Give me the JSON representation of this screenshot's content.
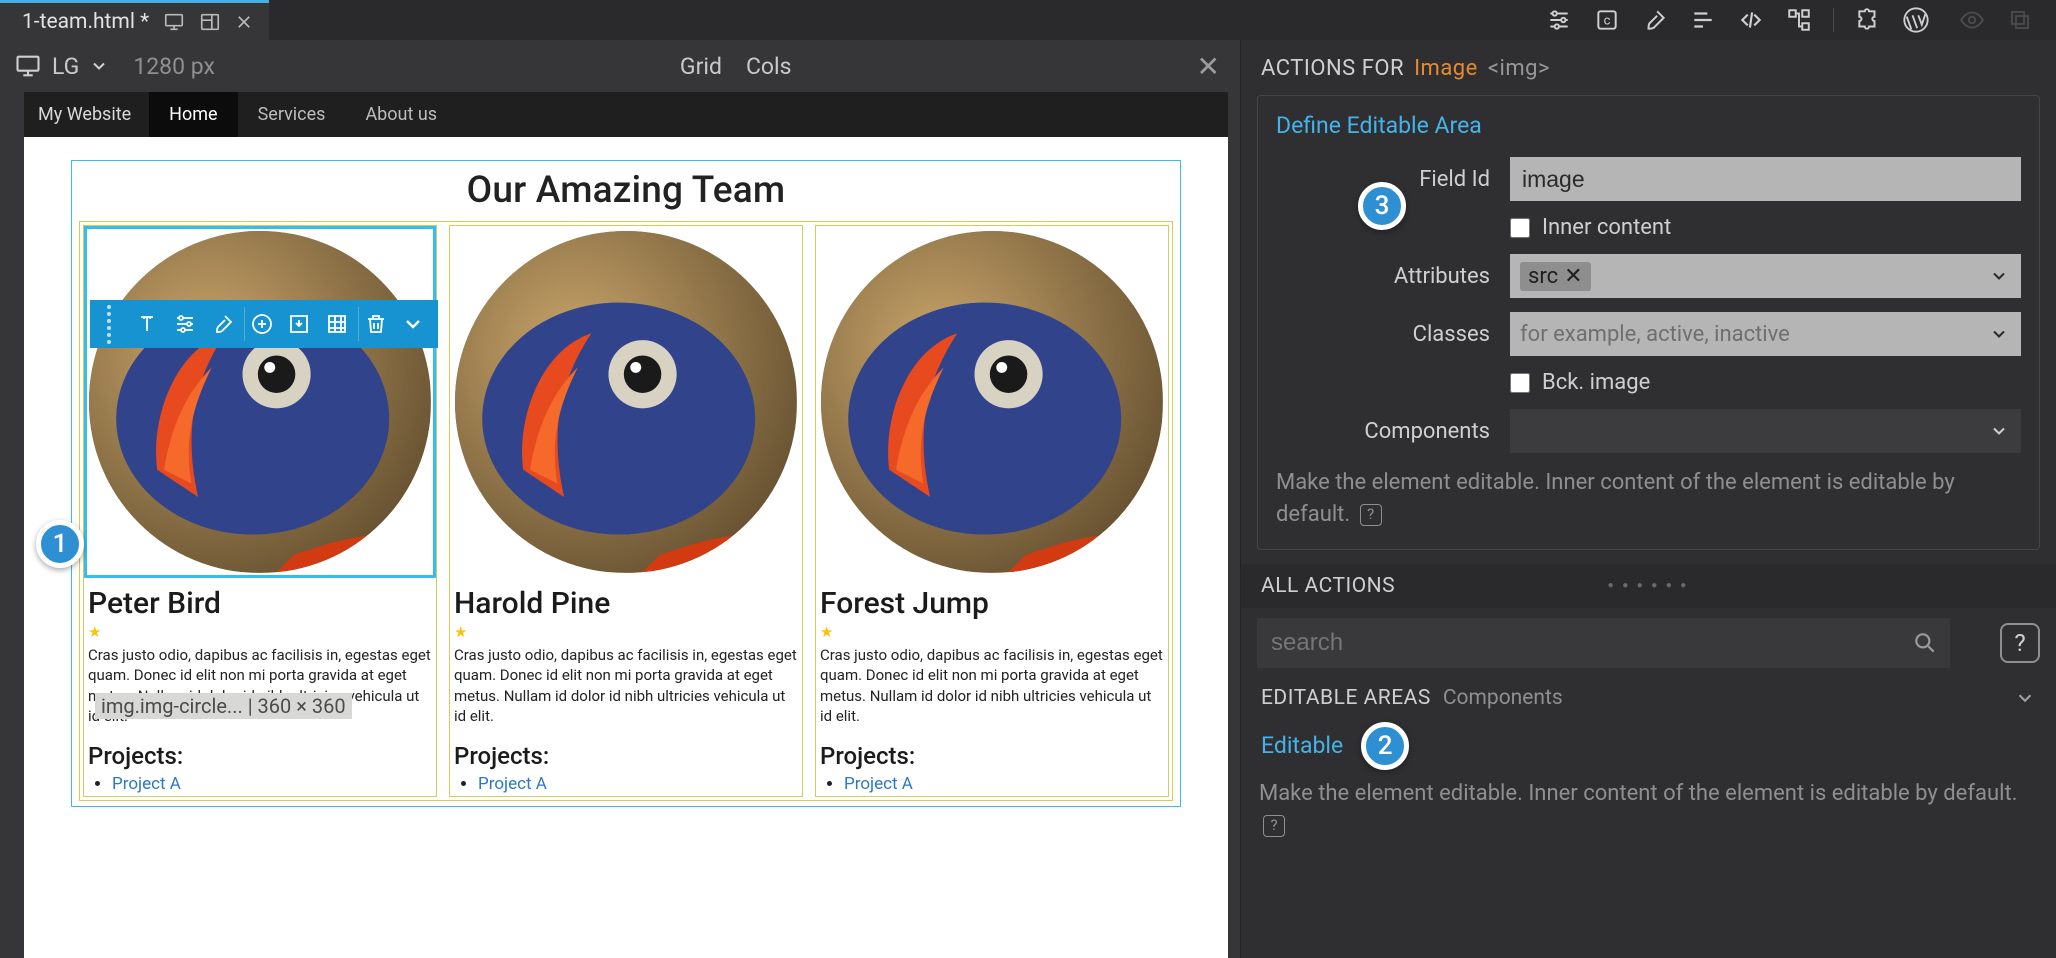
{
  "tab": {
    "filename": "1-team.html *"
  },
  "canvasBar": {
    "device": "LG",
    "width": "1280 px",
    "grid": "Grid",
    "cols": "Cols"
  },
  "siteNav": {
    "brand": "My Website",
    "items": [
      "Home",
      "Services",
      "About us"
    ],
    "activeIndex": 0
  },
  "page": {
    "heading": "Our Amazing Team",
    "cards": [
      {
        "name": "Peter Bird",
        "desc": "Cras justo odio, dapibus ac facilisis in, egestas eget quam. Donec id elit non mi porta gravida at eget metus. Nullam id dolor id nibh ultricies vehicula ut id elit.",
        "projectsLabel": "Projects:",
        "projects": [
          "Project A"
        ]
      },
      {
        "name": "Harold Pine",
        "desc": "Cras justo odio, dapibus ac facilisis in, egestas eget quam. Donec id elit non mi porta gravida at eget metus. Nullam id dolor id nibh ultricies vehicula ut id elit.",
        "projectsLabel": "Projects:",
        "projects": [
          "Project A"
        ]
      },
      {
        "name": "Forest Jump",
        "desc": "Cras justo odio, dapibus ac facilisis in, egestas eget quam. Donec id elit non mi porta gravida at eget metus. Nullam id dolor id nibh ultricies vehicula ut id elit.",
        "projectsLabel": "Projects:",
        "projects": [
          "Project A"
        ]
      }
    ],
    "selectedInfo": "img.img-circle...  |  360 × 360"
  },
  "badges": {
    "b1": "1",
    "b2": "2",
    "b3": "3"
  },
  "rp": {
    "header": {
      "prefix": "ACTIONS FOR",
      "el": "Image",
      "tag": "<img>"
    },
    "define": {
      "title": "Define Editable Area",
      "fieldIdLabel": "Field Id",
      "fieldIdValue": "image",
      "innerContent": "Inner content",
      "attributesLabel": "Attributes",
      "attributesChip": "src",
      "classesLabel": "Classes",
      "classesPlaceholder": "for example, active, inactive",
      "bckImage": "Bck. image",
      "componentsLabel": "Components"
    },
    "help": "Make the element editable. Inner content of the element is editable by default.",
    "allActions": "ALL ACTIONS",
    "searchPlaceholder": "search",
    "editableAreasLabel": "EDITABLE AREAS",
    "editableAreasMuted": "Components",
    "editable": "Editable"
  }
}
